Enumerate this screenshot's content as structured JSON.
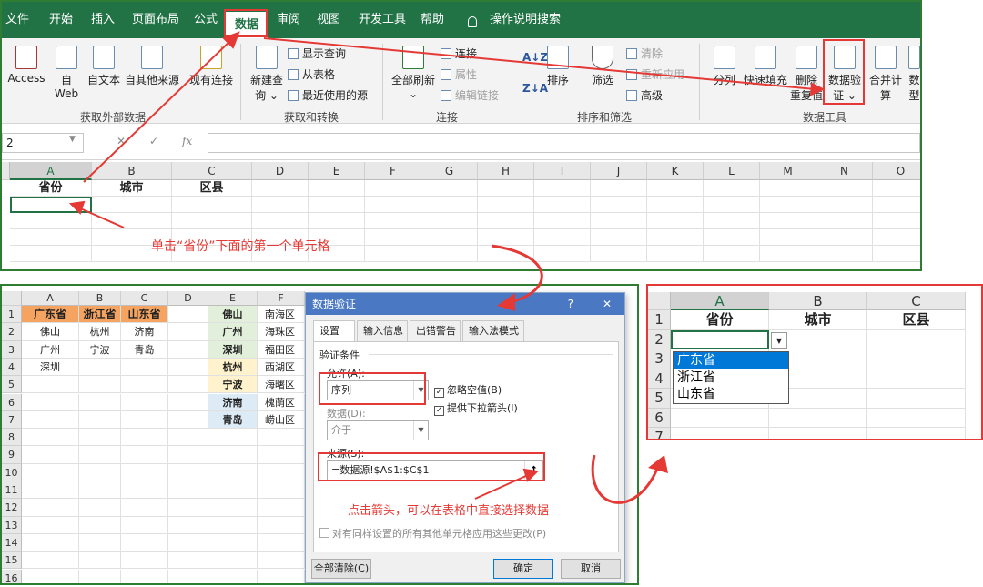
{
  "top_panel": {
    "tabs": [
      "文件",
      "开始",
      "插入",
      "页面布局",
      "公式",
      "数据",
      "审阅",
      "视图",
      "开发工具",
      "帮助"
    ],
    "active_tab": "数据",
    "tell_me": "操作说明搜索",
    "ribbon": {
      "access": "Access",
      "web_1": "自",
      "web_2": "Web",
      "text": "自文本",
      "other": "自其他来源",
      "existing": "现有连接",
      "new_query_1": "新建查",
      "new_query_2": "询 ⌄",
      "show_query": "显示查询",
      "from_table": "从表格",
      "recent": "最近使用的源",
      "refresh_1": "全部刷新",
      "refresh_2": "⌄",
      "connections": "连接",
      "properties": "属性",
      "edit_links": "编辑链接",
      "sort": "排序",
      "filter": "筛选",
      "clear": "清除",
      "reapply": "重新应用",
      "advanced": "高级",
      "split": "分列",
      "flash_fill": "快速填充",
      "remove_dup_1": "删除",
      "remove_dup_2": "重复值",
      "validation_1": "数据验",
      "validation_2": "证 ⌄",
      "consolidate": "合并计算",
      "data_model": "数",
      "data_model_2": "型",
      "groups": [
        "获取外部数据",
        "获取和转换",
        "连接",
        "排序和筛选",
        "数据工具"
      ]
    },
    "name_box": "2",
    "fx": "fx",
    "columns": [
      "A",
      "B",
      "C",
      "D",
      "E",
      "F",
      "G",
      "H",
      "I",
      "J",
      "K",
      "L",
      "M",
      "N",
      "O"
    ],
    "headers": [
      "省份",
      "城市",
      "区县"
    ],
    "annotation": "单击“省份”下面的第一个单元格"
  },
  "source_panel": {
    "columns": [
      "A",
      "B",
      "C",
      "D",
      "E",
      "F"
    ],
    "rows": [
      "1",
      "2",
      "3",
      "4",
      "5",
      "6",
      "7",
      "8",
      "9",
      "10",
      "11",
      "12",
      "13",
      "14",
      "15",
      "16"
    ],
    "provinces": [
      "广东省",
      "浙江省",
      "山东省"
    ],
    "grid": [
      [
        "佛山",
        "杭州",
        "济南"
      ],
      [
        "广州",
        "宁波",
        "青岛"
      ],
      [
        "深圳",
        "",
        ""
      ]
    ],
    "cities": [
      "佛山",
      "广州",
      "深圳",
      "杭州",
      "宁波",
      "济南",
      "青岛"
    ],
    "districts": [
      "南海区",
      "海珠区",
      "福田区",
      "西湖区",
      "海曙区",
      "槐荫区",
      "崂山区"
    ],
    "city_colors": [
      "#e2efda",
      "#e2efda",
      "#e2efda",
      "#fff2cc",
      "#fff2cc",
      "#ddebf7",
      "#ddebf7"
    ],
    "header_color": "#f4a460",
    "dialog": {
      "title": "数据验证",
      "help": "?",
      "close": "✕",
      "tabs": [
        "设置",
        "输入信息",
        "出错警告",
        "输入法模式"
      ],
      "section": "验证条件",
      "allow_label": "允许(A):",
      "allow_value": "序列",
      "ignore_blank": "忽略空值(B)",
      "dropdown": "提供下拉箭头(I)",
      "data_label": "数据(D):",
      "data_value": "介于",
      "source_label": "来源(S):",
      "source_value": "=数据源!$A$1:$C$1",
      "apply_all": "对有同样设置的所有其他单元格应用这些更改(P)",
      "clear_all": "全部清除(C)",
      "ok": "确定",
      "cancel": "取消"
    },
    "annotation": "点击箭头，可以在表格中直接选择数据"
  },
  "result_panel": {
    "columns": [
      "A",
      "B",
      "C"
    ],
    "rows": [
      "1",
      "2",
      "3",
      "4",
      "5",
      "6",
      "7"
    ],
    "headers": [
      "省份",
      "城市",
      "区县"
    ],
    "options": [
      "广东省",
      "浙江省",
      "山东省"
    ],
    "selected_option": "广东省"
  },
  "colors": {
    "excel_green": "#217346",
    "annotation_red": "#e53935",
    "selection_blue": "#0078d7"
  }
}
